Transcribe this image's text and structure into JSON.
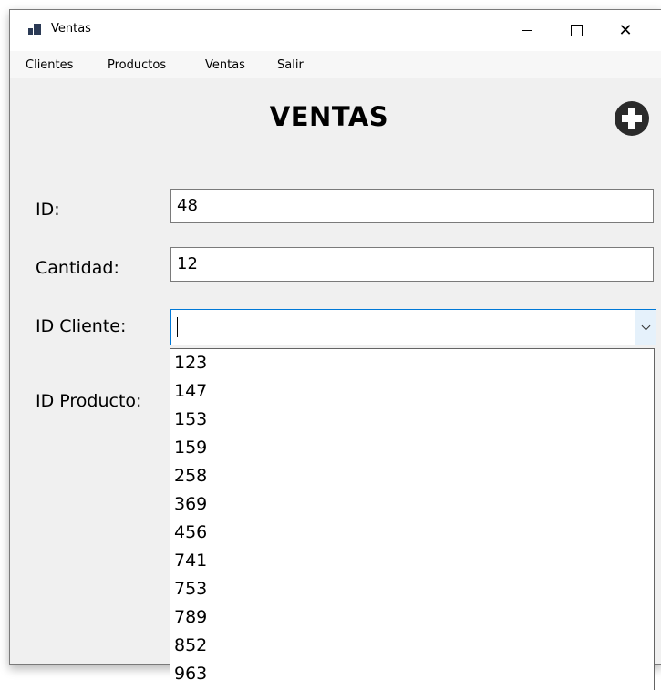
{
  "window": {
    "title": "Ventas",
    "close_symbol": "✕"
  },
  "menu": {
    "items": [
      "Clientes",
      "Productos",
      "Ventas",
      "Salir"
    ]
  },
  "form": {
    "heading": "VENTAS",
    "add_icon": "plus-circle-icon",
    "fields": {
      "id": {
        "label": "ID:",
        "value": "48"
      },
      "cantidad": {
        "label": "Cantidad:",
        "value": "12"
      },
      "id_cliente": {
        "label": "ID Cliente:",
        "value": ""
      },
      "id_producto": {
        "label": "ID Producto:"
      }
    }
  },
  "dropdown": {
    "options": [
      "123",
      "147",
      "153",
      "159",
      "258",
      "369",
      "456",
      "741",
      "753",
      "789",
      "852",
      "963"
    ]
  },
  "colors": {
    "focus_border": "#0078d7",
    "form_background": "#f0f0f0"
  }
}
